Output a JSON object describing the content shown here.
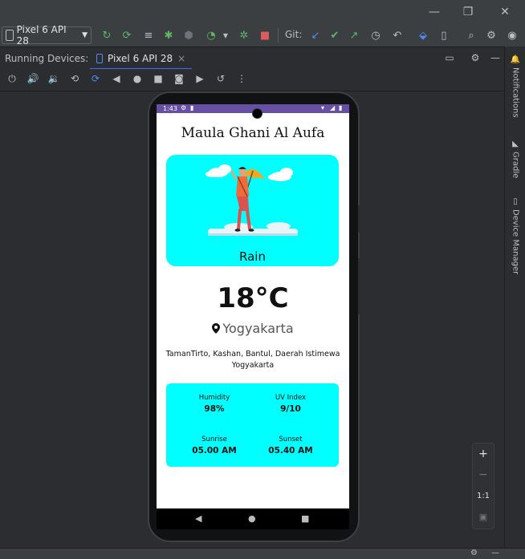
{
  "toolbar": {
    "device": "Pixel 6 API 28",
    "git_label": "Git:"
  },
  "running_devices": {
    "label": "Running Devices:",
    "tab_label": "Pixel 6 API 28",
    "tab_close": "×"
  },
  "sidebar": {
    "notifications": "Notifications",
    "gradle": "Gradle",
    "device_manager": "Device Manager"
  },
  "zoom": {
    "plus": "+",
    "minus": "−",
    "one_to_one": "1:1"
  },
  "phone": {
    "status_time": "1:43",
    "app_title": "Maula Ghani Al Aufa",
    "weather": "Rain",
    "temperature": "18°C",
    "city": "Yogyakarta",
    "address": "TamanTirto, Kashan, Bantul, Daerah Istimewa Yogyakarta",
    "humidity_label": "Humidity",
    "humidity_value": "98%",
    "uv_label": "UV Index",
    "uv_value": "9/10",
    "sunrise_label": "Sunrise",
    "sunrise_value": "05.00 AM",
    "sunset_label": "Sunset",
    "sunset_value": "05.40 AM"
  },
  "colors": {
    "card": "#00ffff",
    "status_bar": "#6750a4",
    "ide_bg": "#2b2d30"
  }
}
